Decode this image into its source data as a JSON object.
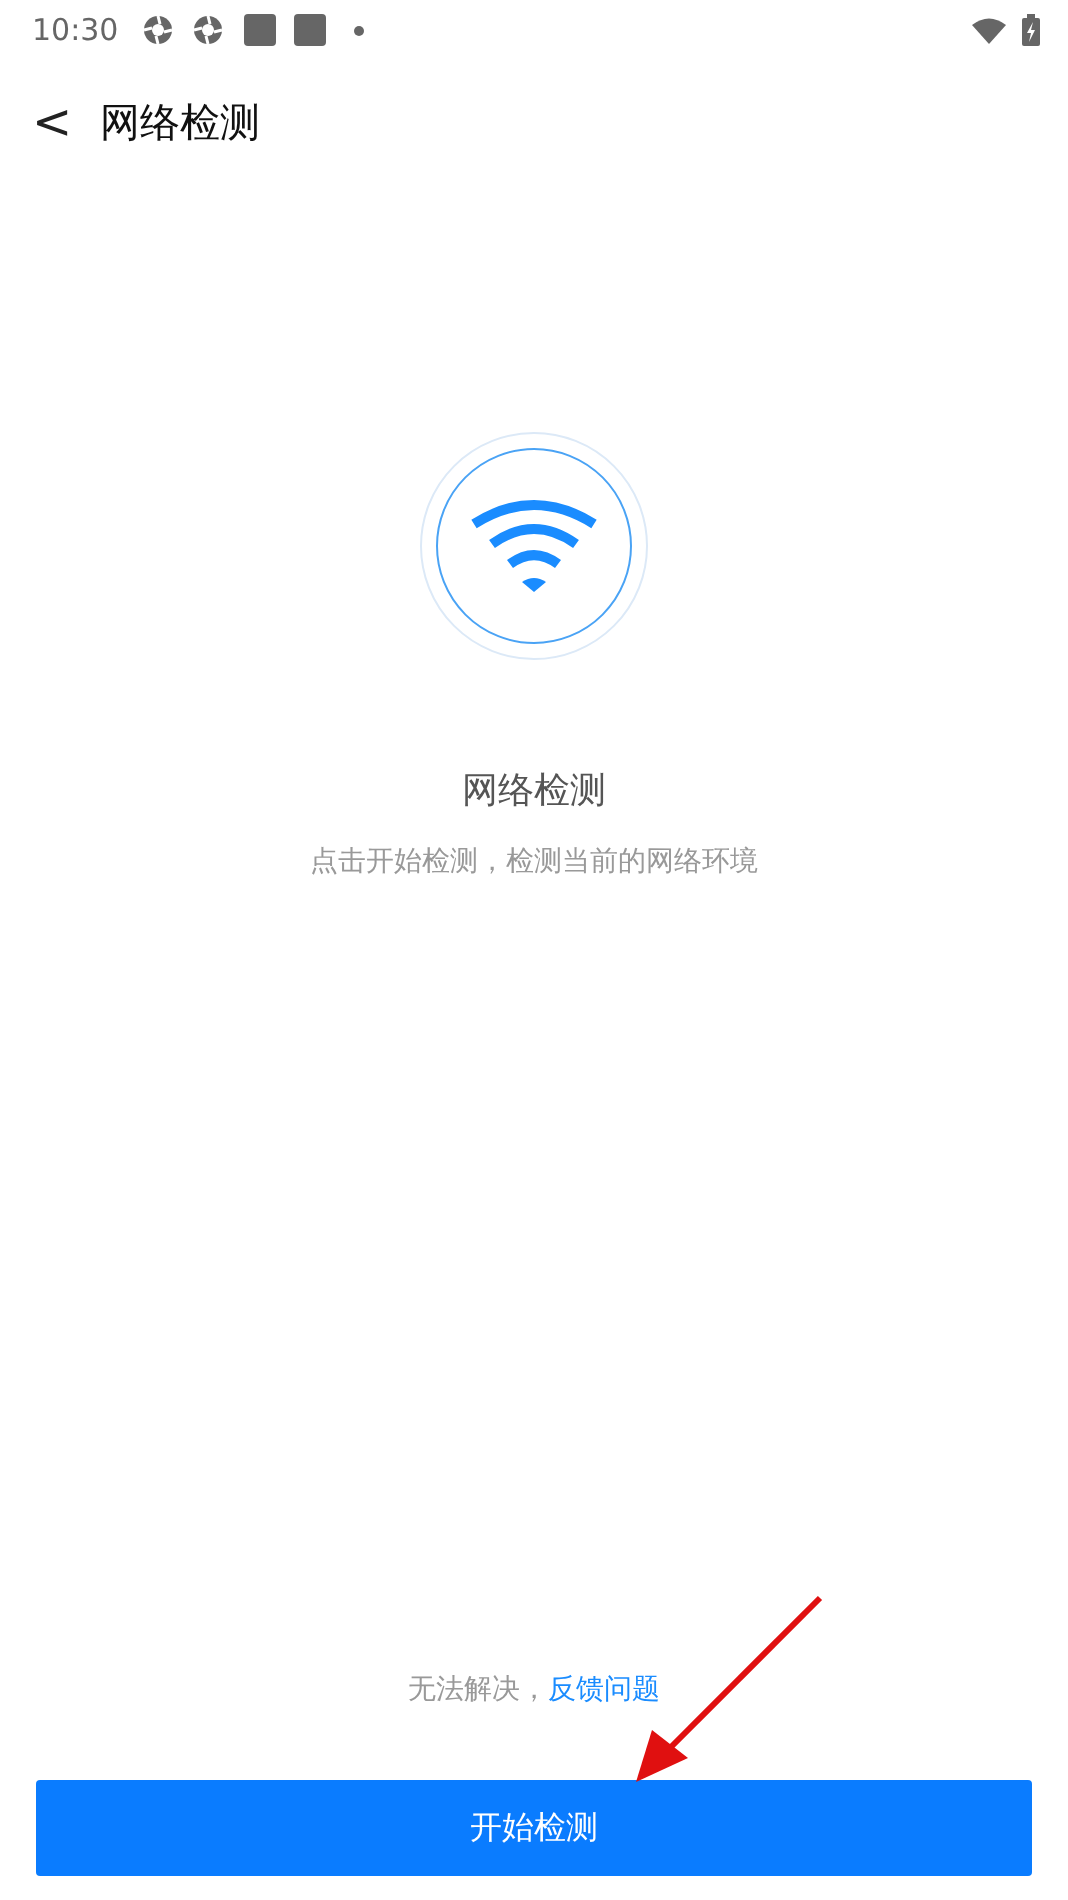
{
  "status_bar": {
    "time": "10:30"
  },
  "header": {
    "back": "<",
    "title": "网络检测"
  },
  "main": {
    "title": "网络检测",
    "subtitle": "点击开始检测，检测当前的网络环境"
  },
  "feedback": {
    "text": "无法解决，",
    "link": "反馈问题"
  },
  "start_button": "开始检测"
}
